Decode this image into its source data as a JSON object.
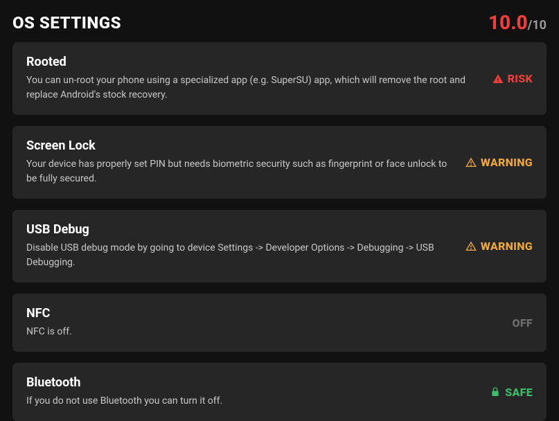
{
  "header": {
    "title": "OS SETTINGS",
    "score": "10.0",
    "score_max": "/10"
  },
  "items": [
    {
      "title": "Rooted",
      "desc": "You can un-root your phone using a specialized app (e.g. SuperSU) app, which will remove the root and replace Android's stock recovery.",
      "status": "RISK"
    },
    {
      "title": "Screen Lock",
      "desc": "Your device has properly set PIN but needs biometric security such as fingerprint or face unlock to be fully secured.",
      "status": "WARNING"
    },
    {
      "title": "USB Debug",
      "desc": "Disable USB debug mode by going to device Settings -> Developer Options -> Debugging -> USB Debugging.",
      "status": "WARNING"
    },
    {
      "title": "NFC",
      "desc": "NFC is off.",
      "status": "OFF"
    },
    {
      "title": "Bluetooth",
      "desc": "If you do not use Bluetooth you can turn it off.",
      "status": "SAFE"
    }
  ]
}
